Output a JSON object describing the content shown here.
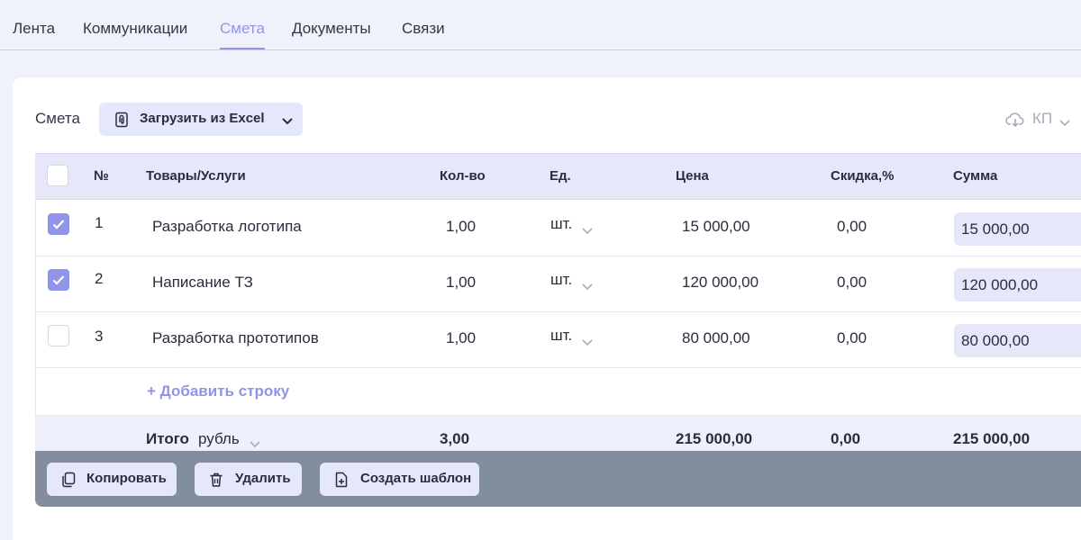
{
  "tabs": [
    {
      "label": "Лента"
    },
    {
      "label": "Коммуникации"
    },
    {
      "label": "Смета"
    },
    {
      "label": "Документы"
    },
    {
      "label": "Связи"
    }
  ],
  "active_tab": "Смета",
  "toolbar": {
    "section_label": "Смета",
    "excel_button_label": "Загрузить из Excel",
    "kp_label": "КП"
  },
  "table": {
    "headers": {
      "num": "№",
      "item": "Товары/Услуги",
      "qty": "Кол-во",
      "unit": "Ед.",
      "price": "Цена",
      "discount": "Скидка,%",
      "sum": "Сумма"
    },
    "rows": [
      {
        "num": "1",
        "item": "Разработка логотипа",
        "qty": "1,00",
        "unit": "шт.",
        "price": "15 000,00",
        "discount": "0,00",
        "sum": "15 000,00",
        "checked": true
      },
      {
        "num": "2",
        "item": "Написание ТЗ",
        "qty": "1,00",
        "unit": "шт.",
        "price": "120 000,00",
        "discount": "0,00",
        "sum": "120 000,00",
        "checked": true
      },
      {
        "num": "3",
        "item": "Разработка прототипов",
        "qty": "1,00",
        "unit": "шт.",
        "price": "80 000,00",
        "discount": "0,00",
        "sum": "80 000,00",
        "checked": false
      }
    ],
    "add_row_label": "+ Добавить строку",
    "total": {
      "label": "Итого",
      "currency": "рубль",
      "qty": "3,00",
      "price": "215 000,00",
      "discount": "0,00",
      "sum": "215 000,00"
    }
  },
  "actions": {
    "copy_label": "Копировать",
    "delete_label": "Удалить",
    "template_label": "Создать шаблон"
  },
  "colors": {
    "accent": "#8f95e8",
    "header_bg": "#e6e8fa",
    "action_bar": "#828d9e"
  }
}
